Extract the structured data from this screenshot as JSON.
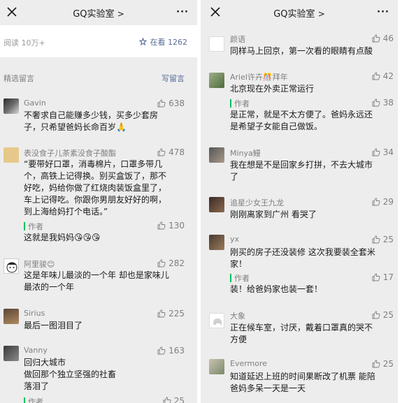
{
  "left": {
    "nav": {
      "title": "GQ实验室",
      "title_chevron": ">",
      "more": "···"
    },
    "stats": {
      "reads": "阅读 10万+",
      "watching": "在看 1262"
    },
    "section": {
      "label": "精选留言",
      "write": "写留言"
    },
    "comments": [
      {
        "author": "Gavin",
        "likes": "638",
        "text": "不奢求自己能赚多少钱，买多少套房\n子，只希望爸妈长命百岁🙏"
      },
      {
        "author": "表没食子儿茶素没食子酸酯",
        "likes": "478",
        "text": "“要带好口罩，消毒棉片，口罩多带几\n个，高铁上记得换。别买盒饭了，那不\n好吃，妈给你做了红烧肉装饭盒里了，\n车上记得吃。你跟你男朋友好好的啊，\n到上海给妈打个电话。”",
        "reply_label": "作者",
        "reply_likes": "130",
        "reply_text": "这就是我妈妈😘😘😘"
      },
      {
        "author": "阿里骏😊",
        "likes": "282",
        "text": "这是年味儿最淡的一个年 却也是家味儿\n最浓的一个年"
      },
      {
        "author": "Sirius",
        "likes": "225",
        "text": "最后一图泪目了"
      },
      {
        "author": "Vanny",
        "likes": "163",
        "text": "回归大城市\n做回那个独立坚强的社畜\n落泪了",
        "reply_label": "作者",
        "reply_likes": "25"
      }
    ]
  },
  "right": {
    "nav": {
      "title": "GQ实验室",
      "title_chevron": ">",
      "more": "···"
    },
    "comments": [
      {
        "author": "颜语",
        "likes": "46",
        "text": "同样马上回京，第一次看的眼睛有点酸"
      },
      {
        "author": "Ariel许卉🎊拜年",
        "likes": "42",
        "text": "北京现在外卖正常运行",
        "reply_label": "作者",
        "reply_likes": "38",
        "reply_text": "是正常，就是不太方便了。爸妈永远还\n是希望子女能自己做饭。"
      },
      {
        "author": "Minya鳗",
        "likes": "34",
        "text": "我在想是不是回家乡打拼，不去大城市\n了"
      },
      {
        "author": "追星少女王九龙",
        "likes": "29",
        "text": "刚刚离家到广州 看哭了"
      },
      {
        "author": "yx",
        "likes": "25",
        "text": "刚买的房子还没装修 这次我要装全套米\n家！",
        "reply_label": "作者",
        "reply_likes": "17",
        "reply_text": "装！给爸妈家也装一套！"
      },
      {
        "author": "大象",
        "likes": "25",
        "text": "正在候车室，讨厌，戴着口罩真的哭不\n方便"
      },
      {
        "author": "Evermore",
        "likes": "25",
        "text": "知道延迟上班的时间果断改了机票 能陪\n爸妈多呆一天是一天"
      }
    ]
  },
  "colors": {
    "link": "#576b95",
    "author_bar": "#07c160",
    "background": "#ededed"
  }
}
